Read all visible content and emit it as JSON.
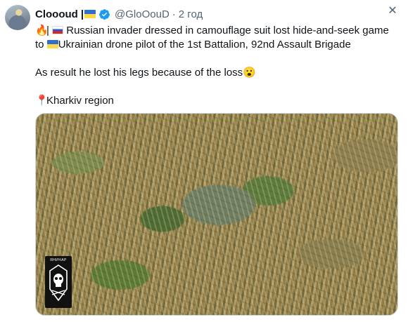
{
  "tweet": {
    "author_name": "Cloooud",
    "name_separator": "|",
    "handle": "@GloOouD",
    "time_separator": "·",
    "time": "2 год",
    "close_glyph": "✕",
    "line1": "Russian invader dressed in camouflage suit lost hide-and-seek game",
    "line2_prefix": "to",
    "line2": "Ukrainian drone pilot of the 1st Battalion, 92nd Assault Brigade",
    "line3": "As result he lost his legs because of the loss",
    "line4": "Kharkiv region",
    "emoji_fire": "🔥",
    "emoji_pin": "📍",
    "emoji_face": "😮",
    "badge_text": "ЯНИЧАР"
  },
  "colors": {
    "verified": "#1d9bf0",
    "secondary_text": "#536471",
    "flag_blue": "#2f6fd1",
    "flag_yellow": "#ffd84a"
  },
  "icons": {
    "verified": "verified-check-icon",
    "close": "close-icon",
    "fire": "fire-emoji",
    "pin": "pin-emoji",
    "face": "face-emoji",
    "unit_badge": "skull-badge-icon"
  }
}
